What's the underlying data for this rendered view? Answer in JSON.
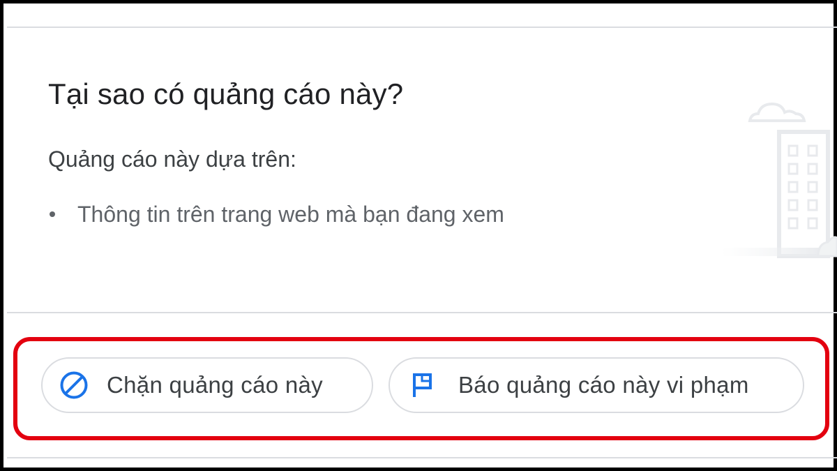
{
  "panel": {
    "title": "Tại sao có quảng cáo này?",
    "subtitle": "Quảng cáo này dựa trên:",
    "reasons": [
      "Thông tin trên trang web mà bạn đang xem"
    ]
  },
  "actions": {
    "block": {
      "label": "Chặn quảng cáo này",
      "icon": "block-icon"
    },
    "report": {
      "label": "Báo quảng cáo này vi phạm",
      "icon": "flag-icon"
    }
  },
  "colors": {
    "accent_blue": "#1a73e8",
    "highlight_red": "#e3000f",
    "divider": "#dadce0"
  }
}
